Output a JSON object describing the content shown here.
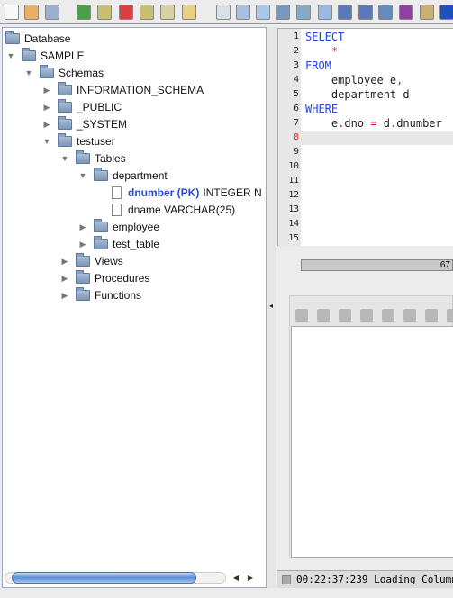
{
  "toolbar": {
    "icons": [
      "new-file",
      "open-folder",
      "save",
      "connect",
      "disconnect",
      "stop",
      "new-database",
      "database",
      "script",
      "properties",
      "import",
      "export",
      "bookmark",
      "help-book",
      "rows",
      "format-sql",
      "add-lines",
      "edit-lines",
      "color-lines",
      "schema",
      "favorite-star"
    ]
  },
  "tree": {
    "items": [
      {
        "label": "Database",
        "level": 0,
        "state": "none",
        "icon": "folder"
      },
      {
        "label": "SAMPLE",
        "level": 0,
        "state": "open",
        "icon": "folder"
      },
      {
        "label": "Schemas",
        "level": 1,
        "state": "open",
        "icon": "folder"
      },
      {
        "label": "INFORMATION_SCHEMA",
        "level": 2,
        "state": "closed",
        "icon": "folder"
      },
      {
        "label": "_PUBLIC",
        "level": 2,
        "state": "closed",
        "icon": "folder"
      },
      {
        "label": "_SYSTEM",
        "level": 2,
        "state": "closed",
        "icon": "folder"
      },
      {
        "label": "testuser",
        "level": 2,
        "state": "open",
        "icon": "folder"
      },
      {
        "label": "Tables",
        "level": 3,
        "state": "open",
        "icon": "folder"
      },
      {
        "label": "department",
        "level": 4,
        "state": "open",
        "icon": "folder"
      },
      {
        "label": "INTEGER N",
        "pk": "dnumber (PK)",
        "level": 5,
        "state": "none",
        "icon": "doc"
      },
      {
        "label": "dname VARCHAR(25)",
        "level": 5,
        "state": "none",
        "icon": "doc"
      },
      {
        "label": "employee",
        "level": 4,
        "state": "closed",
        "icon": "folder"
      },
      {
        "label": "test_table",
        "level": 4,
        "state": "closed",
        "icon": "folder"
      },
      {
        "label": "Views",
        "level": 3,
        "state": "closed",
        "icon": "folder"
      },
      {
        "label": "Procedures",
        "level": 3,
        "state": "closed",
        "icon": "folder"
      },
      {
        "label": "Functions",
        "level": 3,
        "state": "closed",
        "icon": "folder"
      }
    ]
  },
  "editor": {
    "line_count": 15,
    "current_line": 8,
    "lines": [
      [
        {
          "t": "SELECT",
          "c": "kw"
        }
      ],
      [
        {
          "t": "    "
        },
        {
          "t": "*",
          "c": "red"
        }
      ],
      [
        {
          "t": "FROM",
          "c": "kw"
        }
      ],
      [
        {
          "t": "    employee e"
        },
        {
          "t": ",",
          "c": "red"
        }
      ],
      [
        {
          "t": "    department d"
        }
      ],
      [
        {
          "t": "WHERE",
          "c": "kw"
        }
      ],
      [
        {
          "t": "    e"
        },
        {
          "t": ".",
          "c": "red"
        },
        {
          "t": "dno "
        },
        {
          "t": "=",
          "c": "red"
        },
        {
          "t": " d"
        },
        {
          "t": ".",
          "c": "red"
        },
        {
          "t": "dnumber"
        }
      ]
    ]
  },
  "progress": {
    "label": "67"
  },
  "status": {
    "text": "00:22:37:239 Loading Columns"
  }
}
